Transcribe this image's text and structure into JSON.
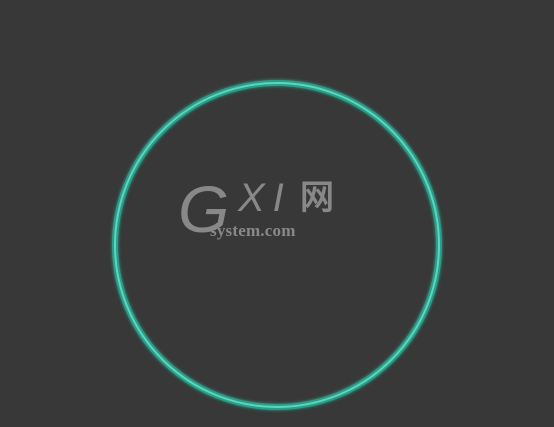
{
  "watermark": {
    "logo_letter": "G",
    "logo_letters": "XI",
    "logo_cn": "网",
    "domain": "system.com"
  },
  "colors": {
    "background": "#383838",
    "ring": "#35b8a0",
    "ring_highlight": "#6fe0c8",
    "watermark": "#8f8f8f"
  }
}
